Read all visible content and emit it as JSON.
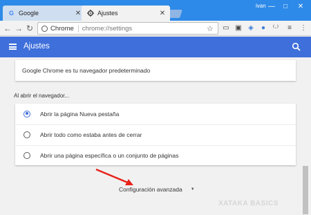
{
  "tabs": [
    {
      "label": "Google",
      "favicon": "google-icon",
      "active": false
    },
    {
      "label": "Ajustes",
      "favicon": "gear-icon",
      "active": true
    }
  ],
  "window": {
    "user_name": "ivan",
    "minimize": "—",
    "maximize": "□",
    "close": "✕"
  },
  "toolbar": {
    "site_chip": "Chrome",
    "url": "chrome://settings"
  },
  "header": {
    "title": "Ajustes"
  },
  "default_browser": {
    "text": "Google Chrome es tu navegador predeterminado"
  },
  "on_startup": {
    "title": "Al abrir el navegador...",
    "options": [
      {
        "label": "Abrir la página Nueva pestaña",
        "checked": true
      },
      {
        "label": "Abrir todo como estaba antes de cerrar",
        "checked": false
      },
      {
        "label": "Abrir una página específica o un conjunto de páginas",
        "checked": false
      }
    ]
  },
  "advanced": {
    "label": "Configuración avanzada"
  },
  "watermark": "XATAKA BASICS",
  "colors": {
    "accent": "#3e6fdb",
    "titlebar": "#2e8ae8",
    "annotation_arrow": "#e8231c"
  }
}
